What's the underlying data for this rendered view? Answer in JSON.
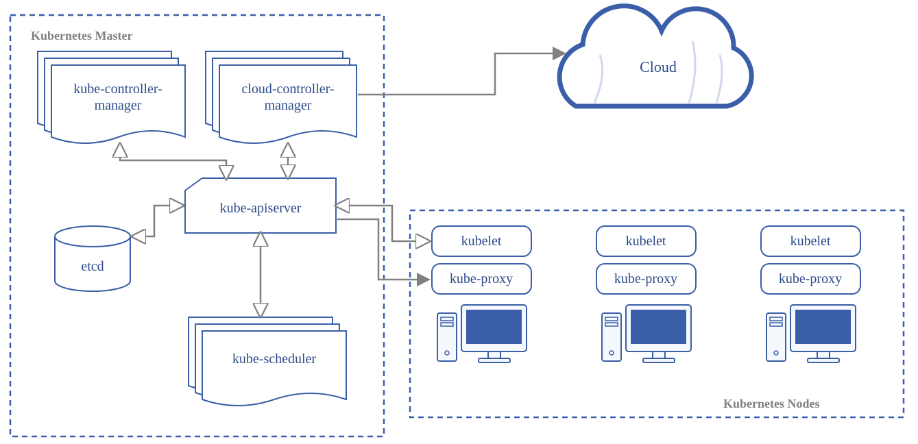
{
  "master": {
    "title": "Kubernetes Master",
    "components": {
      "kubeControllerManager": {
        "line1": "kube-controller-",
        "line2": "manager"
      },
      "cloudControllerManager": {
        "line1": "cloud-controller-",
        "line2": "manager"
      },
      "kubeApiserver": "kube-apiserver",
      "etcd": "etcd",
      "kubeScheduler": "kube-scheduler"
    }
  },
  "cloud": {
    "label": "Cloud"
  },
  "nodes": {
    "title": "Kubernetes Nodes",
    "node": [
      {
        "kubelet": "kubelet",
        "kubeProxy": "kube-proxy"
      },
      {
        "kubelet": "kubelet",
        "kubeProxy": "kube-proxy"
      },
      {
        "kubelet": "kubelet",
        "kubeProxy": "kube-proxy"
      }
    ]
  },
  "colors": {
    "borderBlue": "#3a5fa8",
    "textBlue": "#2c4a8a",
    "grey": "#808080",
    "lightFill": "#f5f8fc"
  }
}
